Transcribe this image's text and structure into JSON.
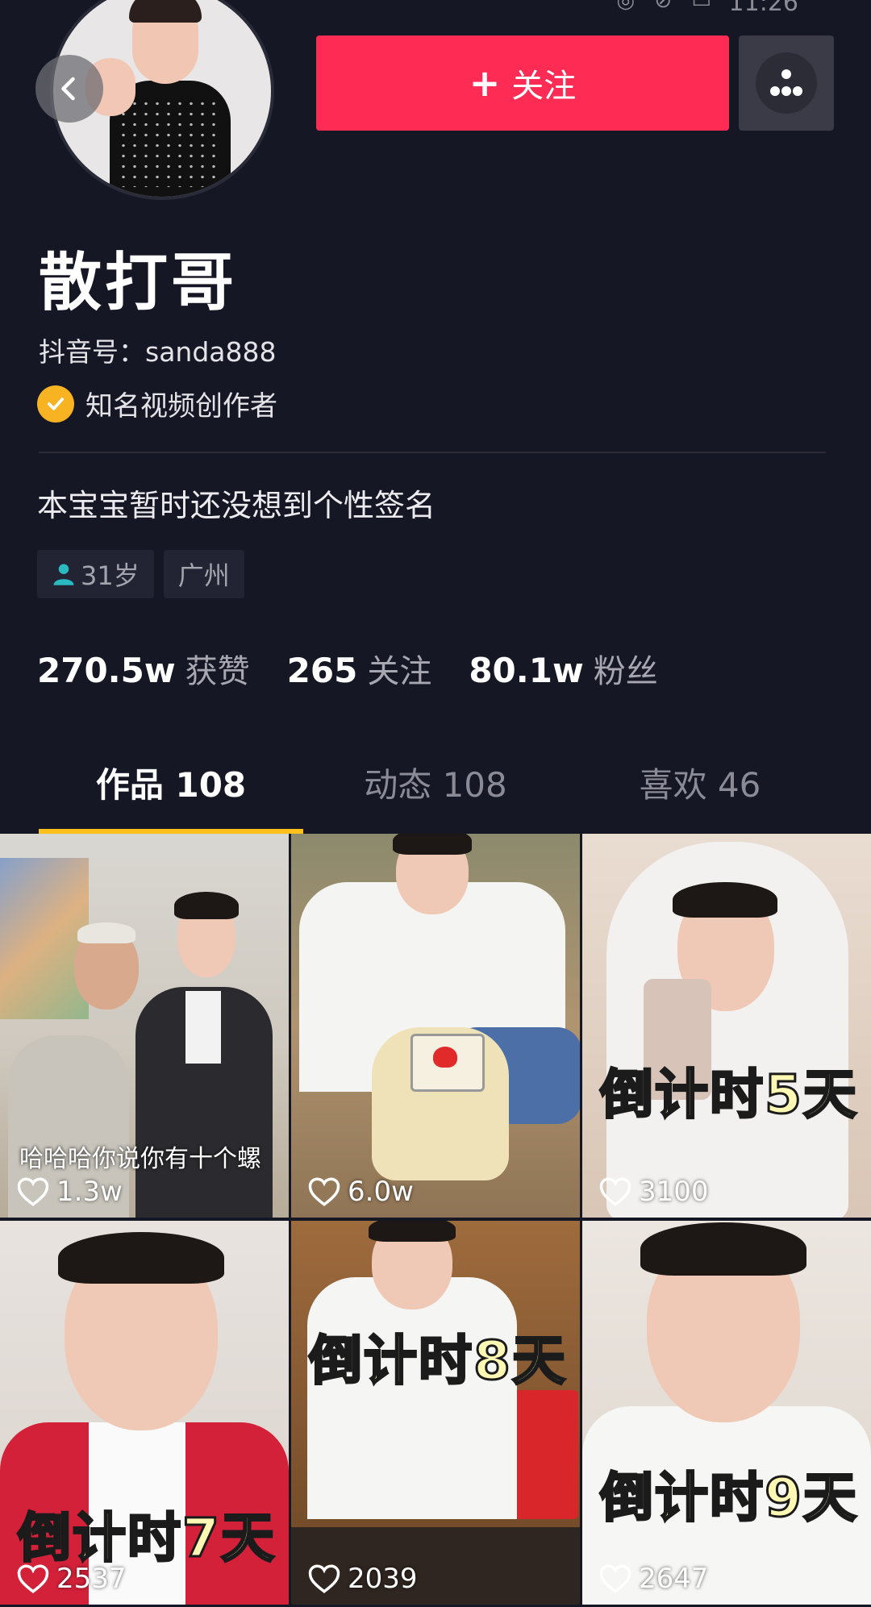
{
  "status_bar": {
    "time": "11:26",
    "icons": "◎ ⊘ ▭"
  },
  "profile": {
    "follow_label": "关注",
    "follow_plus": "+",
    "name": "散打哥",
    "douyin_id": "抖音号：sanda888",
    "verified_label": "知名视频创作者",
    "signature": "本宝宝暂时还没想到个性签名",
    "tags": {
      "age": "31岁",
      "city": "广州"
    },
    "stats": [
      {
        "value": "270.5w",
        "label": "获赞"
      },
      {
        "value": "265",
        "label": "关注"
      },
      {
        "value": "80.1w",
        "label": "粉丝"
      }
    ]
  },
  "tabs": [
    {
      "label": "作品 108",
      "active": true
    },
    {
      "label": "动态 108",
      "active": false
    },
    {
      "label": "喜欢 46",
      "active": false
    }
  ],
  "videos": [
    {
      "likes": "1.3w",
      "subtitle": "哈哈哈你说你有十个螺",
      "overlay": ""
    },
    {
      "likes": "6.0w",
      "subtitle": "",
      "overlay": ""
    },
    {
      "likes": "3100",
      "subtitle": "",
      "overlay": "倒计时5天"
    },
    {
      "likes": "2537",
      "subtitle": "",
      "overlay": "倒计时7天"
    },
    {
      "likes": "2039",
      "subtitle": "",
      "overlay": "倒计时8天"
    },
    {
      "likes": "2647",
      "subtitle": "",
      "overlay": "倒计时9天"
    }
  ],
  "icons": {
    "back": "chevron-left-icon",
    "more": "more-dots-icon",
    "verified": "checkmark-badge-icon",
    "age": "person-icon",
    "likes": "heart-outline-icon"
  },
  "colors": {
    "accent": "#fe2c55",
    "tab_indicator": "#fcc11c",
    "verified": "#f8b322",
    "background": "#161724"
  }
}
